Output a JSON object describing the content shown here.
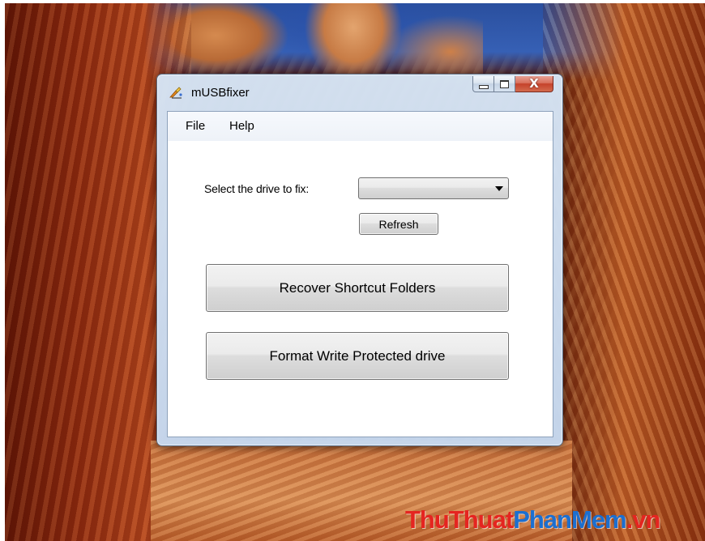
{
  "window": {
    "title": "mUSBfixer",
    "caption_buttons": {
      "minimize_icon": "minimize-icon",
      "maximize_icon": "maximize-icon",
      "close_icon": "close-icon",
      "close_glyph": "X"
    }
  },
  "menu": {
    "items": [
      {
        "label": "File"
      },
      {
        "label": "Help"
      }
    ]
  },
  "form": {
    "drive_label": "Select the drive to fix:",
    "drive_select_value": "",
    "refresh_label": "Refresh",
    "recover_label": "Recover Shortcut Folders",
    "format_label": "Format Write Protected drive"
  },
  "watermark": {
    "part1": "ThuThuat",
    "part2": "PhanMem",
    "part3": ".vn"
  },
  "colors": {
    "watermark_red": "#e52520",
    "watermark_blue": "#1c6fd0",
    "close_button": "#c5412a"
  }
}
